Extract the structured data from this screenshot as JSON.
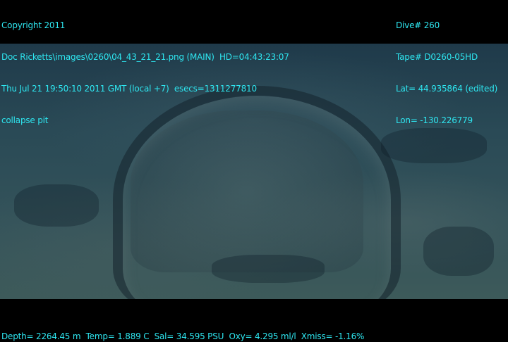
{
  "overlay_top_left": {
    "line1": "Copyright 2011",
    "line2": "Doc Ricketts\\images\\0260\\04_43_21_21.png (MAIN)  HD=04:43:23:07",
    "line3": "Thu Jul 21 19:50:10 2011 GMT (local +7)  esecs=1311277810",
    "line4": "collapse pit"
  },
  "overlay_top_right": {
    "dive": "Dive# 260",
    "tape": "Tape# D0260-05HD",
    "lat": "Lat= 44.935864 (edited)",
    "lon": "Lon= -130.226779"
  },
  "overlay_bottom": {
    "sensors": "Depth= 2264.45 m  Temp= 1.889 C  Sal= 34.595 PSU  Oxy= 4.295 ml/l  Xmiss= -1.16%"
  },
  "colors": {
    "overlay_text": "#2ee6f0",
    "background": "#000000",
    "seafloor": "#2a4a56"
  }
}
